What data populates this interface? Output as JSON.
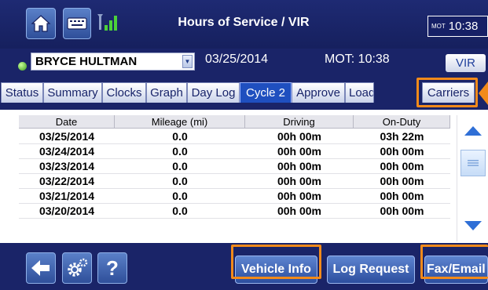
{
  "header": {
    "title": "Hours of Service / VIR",
    "clock_prefix": "MOT",
    "clock_time": "10:38",
    "icons": [
      "home-icon",
      "keyboard-icon",
      "signal-icon"
    ]
  },
  "driver_bar": {
    "driver_name": "BRYCE HULTMAN",
    "date": "03/25/2014",
    "mot_time": "MOT: 10:38",
    "vir_label": "VIR"
  },
  "tabs": [
    {
      "label": "Status"
    },
    {
      "label": "Summary"
    },
    {
      "label": "Clocks"
    },
    {
      "label": "Graph"
    },
    {
      "label": "Day Log"
    },
    {
      "label": "Cycle 2"
    },
    {
      "label": "Approve"
    },
    {
      "label": "Load"
    },
    {
      "label": "Carriers"
    }
  ],
  "active_tab": "Cycle 2",
  "table": {
    "columns": [
      "Date",
      "Mileage (mi)",
      "Driving",
      "On-Duty"
    ],
    "rows": [
      [
        "03/25/2014",
        "0.0",
        "00h 00m",
        "03h 22m"
      ],
      [
        "03/24/2014",
        "0.0",
        "00h 00m",
        "00h 00m"
      ],
      [
        "03/23/2014",
        "0.0",
        "00h 00m",
        "00h 00m"
      ],
      [
        "03/22/2014",
        "0.0",
        "00h 00m",
        "00h 00m"
      ],
      [
        "03/21/2014",
        "0.0",
        "00h 00m",
        "00h 00m"
      ],
      [
        "03/20/2014",
        "0.0",
        "00h 00m",
        "00h 00m"
      ]
    ]
  },
  "footer": {
    "help_label": "?",
    "vehicle_info_label": "Vehicle Info",
    "log_request_label": "Log Request",
    "fax_email_label": "Fax/Email",
    "icons": [
      "back-arrow-icon",
      "gear-icon",
      "help-icon"
    ]
  },
  "colors": {
    "background": "#1a2468",
    "active_tab": "#1f4fbf",
    "highlight": "#f28a1a"
  }
}
